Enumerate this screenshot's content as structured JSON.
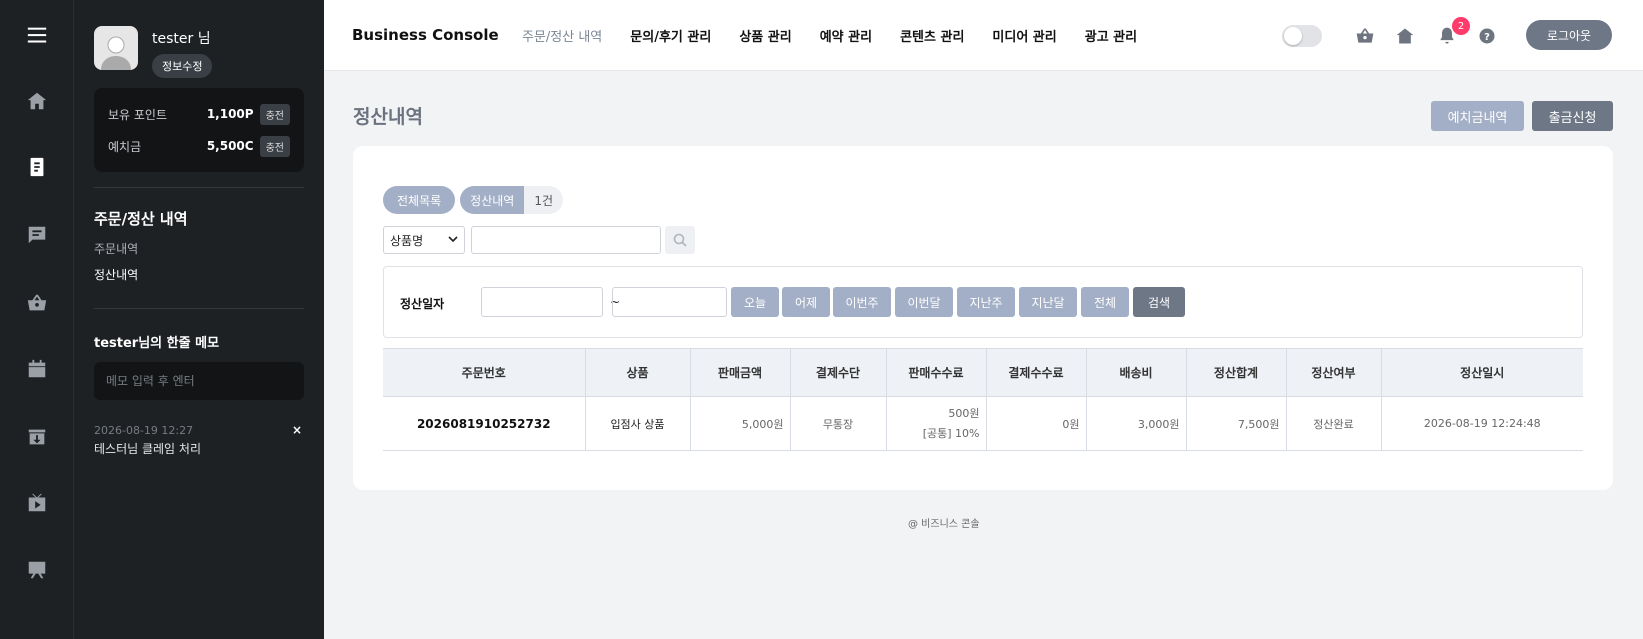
{
  "profile": {
    "name": "tester 님",
    "edit_label": "정보수정"
  },
  "points": [
    {
      "label": "보유 포인트",
      "value": "1,100P",
      "action": "충전"
    },
    {
      "label": "예치금",
      "value": "5,500C",
      "action": "충전"
    }
  ],
  "submenu": {
    "title": "주문/정산 내역",
    "items": [
      "주문내역",
      "정산내역"
    ]
  },
  "memo": {
    "title": "tester님의 한줄 메모",
    "placeholder": "메모 입력 후 엔터",
    "entry_date": "2026-08-19 12:27",
    "entry_text": "테스터님 클레임 처리",
    "close_label": "×"
  },
  "header": {
    "brand": "Business Console",
    "nav": [
      "주문/정산 내역",
      "문의/후기 관리",
      "상품 관리",
      "예약 관리",
      "콘텐츠 관리",
      "미디어 관리",
      "광고 관리"
    ],
    "notification_count": "2",
    "logout_label": "로그아웃"
  },
  "page": {
    "title": "정산내역",
    "deposit_button": "예치금내역",
    "withdraw_button": "출금신청"
  },
  "tabs": {
    "all_label": "전체목록",
    "settle_label": "정산내역",
    "count": "1건"
  },
  "search": {
    "select_value": "상품명",
    "input_value": ""
  },
  "filter": {
    "label": "정산일자",
    "separator": "~",
    "buttons": [
      "오늘",
      "어제",
      "이번주",
      "이번달",
      "지난주",
      "지난달",
      "전체"
    ],
    "search_label": "검색"
  },
  "table": {
    "headers": [
      "주문번호",
      "상품",
      "판매금액",
      "결제수단",
      "판매수수료",
      "결제수수료",
      "배송비",
      "정산합계",
      "정산여부",
      "정산일시"
    ],
    "rows": [
      {
        "order_no": "2026081910252732",
        "product": "입점사 상품",
        "sale_amount": "5,000원",
        "payment": "무통장",
        "sales_fee": "500원",
        "sales_fee_note": "[공통] 10%",
        "payment_fee": "0원",
        "shipping": "3,000원",
        "total": "7,500원",
        "status": "정산완료",
        "settled_at": "2026-08-19 12:24:48"
      }
    ]
  },
  "footer": "@ 비즈니스 콘솔",
  "colors": {
    "sidebar_bg": "#1e2124",
    "accent_pill": "#a3afc6",
    "dark_button": "#6e7786",
    "badge": "#ff3b6b"
  }
}
